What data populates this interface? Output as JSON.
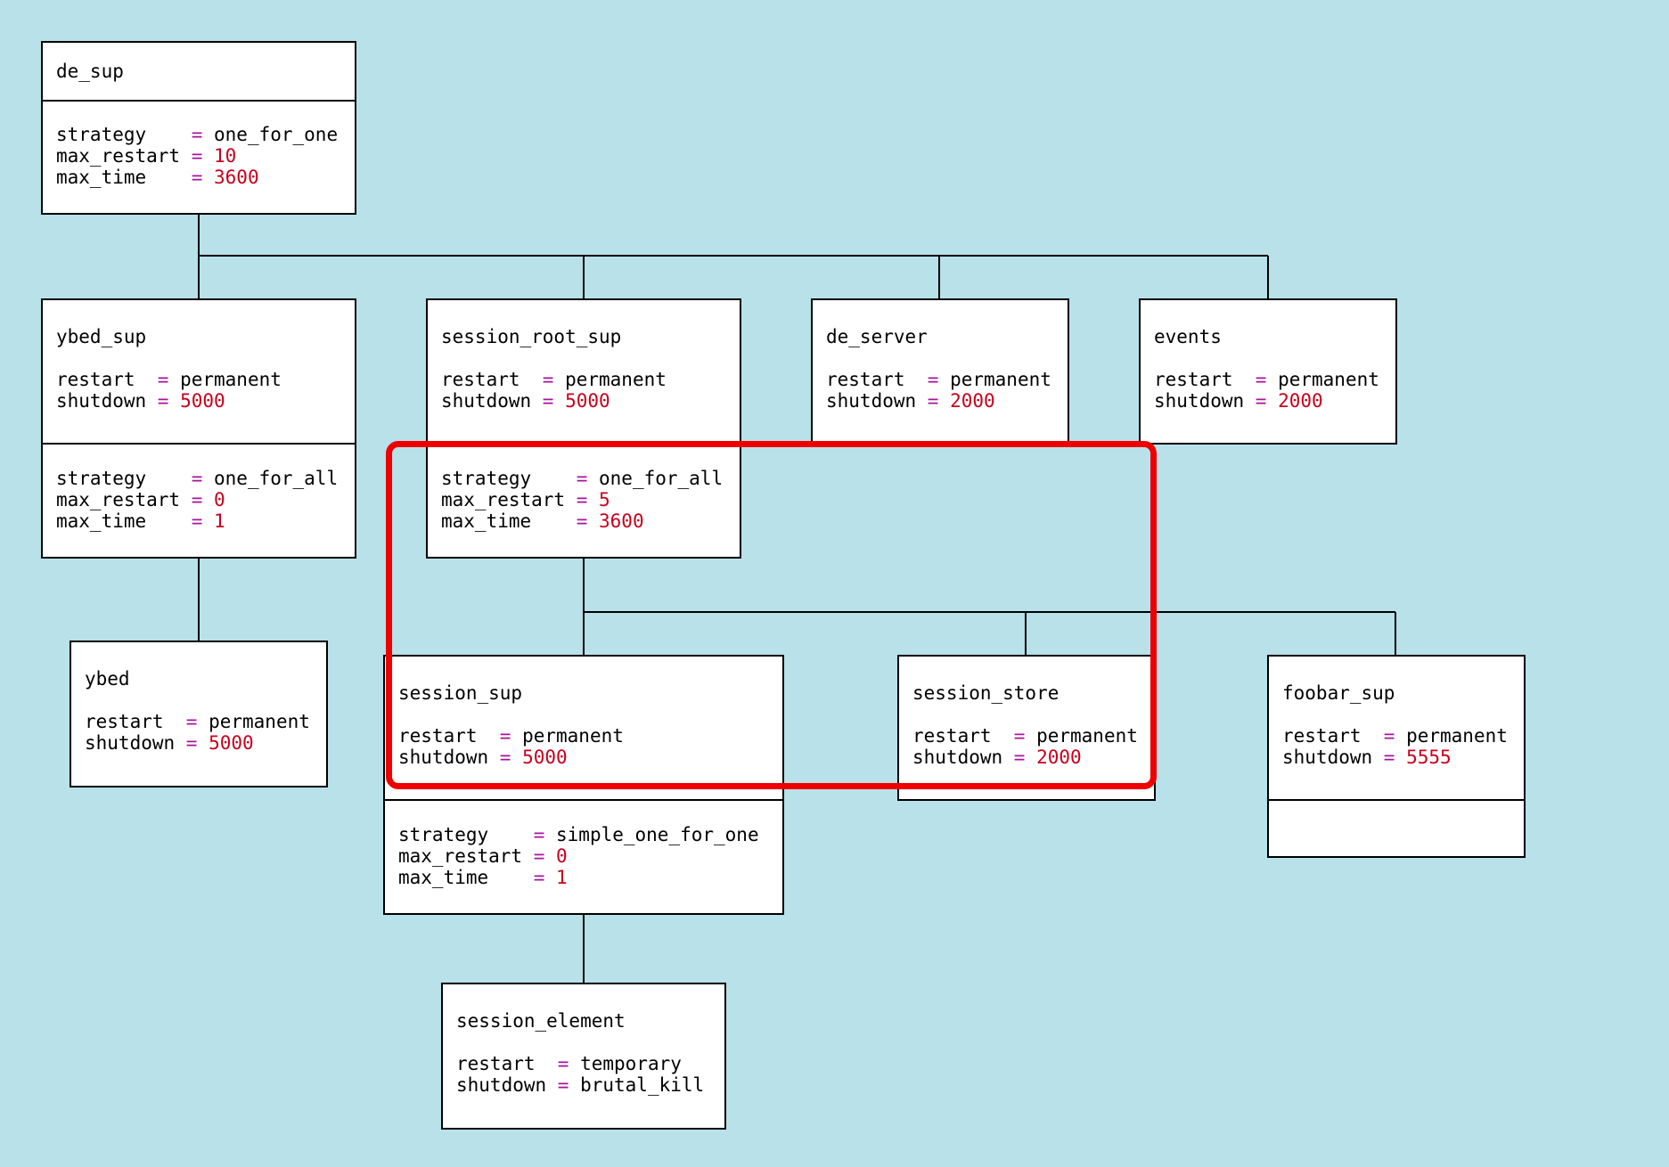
{
  "nodes": [
    {
      "id": "de-sup",
      "name": "de_sup",
      "strategy": [
        [
          "strategy",
          "one_for_one"
        ],
        [
          "max_restart",
          "10"
        ],
        [
          "max_time",
          "3600"
        ]
      ]
    },
    {
      "id": "ybed-sup",
      "name": "ybed_sup",
      "child": [
        [
          "restart",
          "permanent"
        ],
        [
          "shutdown",
          "5000"
        ]
      ],
      "strategy": [
        [
          "strategy",
          "one_for_all"
        ],
        [
          "max_restart",
          "0"
        ],
        [
          "max_time",
          "1"
        ]
      ]
    },
    {
      "id": "session-root-sup",
      "name": "session_root_sup",
      "child": [
        [
          "restart",
          "permanent"
        ],
        [
          "shutdown",
          "5000"
        ]
      ],
      "strategy": [
        [
          "strategy",
          "one_for_all"
        ],
        [
          "max_restart",
          "5"
        ],
        [
          "max_time",
          "3600"
        ]
      ]
    },
    {
      "id": "de-server",
      "name": "de_server",
      "child": [
        [
          "restart",
          "permanent"
        ],
        [
          "shutdown",
          "2000"
        ]
      ]
    },
    {
      "id": "events",
      "name": "events",
      "child": [
        [
          "restart",
          "permanent"
        ],
        [
          "shutdown",
          "2000"
        ]
      ]
    },
    {
      "id": "ybed",
      "name": "ybed",
      "child": [
        [
          "restart",
          "permanent"
        ],
        [
          "shutdown",
          "5000"
        ]
      ]
    },
    {
      "id": "session-sup",
      "name": "session_sup",
      "child": [
        [
          "restart",
          "permanent"
        ],
        [
          "shutdown",
          "5000"
        ]
      ],
      "strategy": [
        [
          "strategy",
          "simple_one_for_one"
        ],
        [
          "max_restart",
          "0"
        ],
        [
          "max_time",
          "1"
        ]
      ]
    },
    {
      "id": "session-store",
      "name": "session_store",
      "child": [
        [
          "restart",
          "permanent"
        ],
        [
          "shutdown",
          "2000"
        ]
      ]
    },
    {
      "id": "foobar-sup",
      "name": "foobar_sup",
      "child": [
        [
          "restart",
          "permanent"
        ],
        [
          "shutdown",
          "5555"
        ]
      ],
      "strategy": []
    },
    {
      "id": "session-element",
      "name": "session_element",
      "child": [
        [
          "restart",
          "temporary"
        ],
        [
          "shutdown",
          "brutal_kill"
        ]
      ]
    }
  ],
  "edges": [
    [
      "de-sup",
      "ybed-sup"
    ],
    [
      "de-sup",
      "session-root-sup"
    ],
    [
      "de-sup",
      "de-server"
    ],
    [
      "de-sup",
      "events"
    ],
    [
      "ybed-sup",
      "ybed"
    ],
    [
      "session-root-sup",
      "session-sup"
    ],
    [
      "session-root-sup",
      "session-store"
    ],
    [
      "session-root-sup",
      "foobar-sup"
    ],
    [
      "session-sup",
      "session-element"
    ]
  ],
  "highlight": {
    "nodes": [
      "session-sup",
      "session-store"
    ],
    "color": "#ee0000"
  },
  "colors": {
    "background": "#b8e1ea",
    "equals": "#a8129e",
    "number": "#c8001c",
    "box": "#ffffff",
    "stroke": "#000000"
  }
}
